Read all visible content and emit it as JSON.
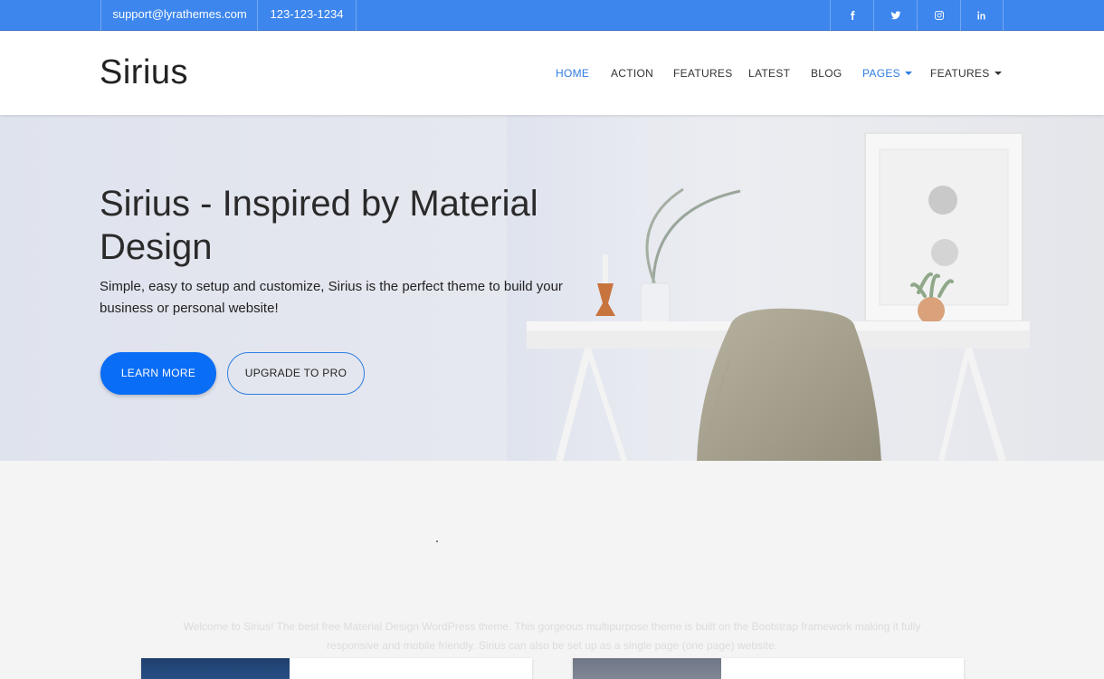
{
  "topbar": {
    "email": "support@lyrathemes.com",
    "phone": "123-123-1234",
    "social": [
      "facebook-icon",
      "twitter-icon",
      "instagram-icon",
      "linkedin-icon"
    ]
  },
  "header": {
    "logo": "Sirius",
    "nav": [
      {
        "label": "HOME",
        "active": true
      },
      {
        "label": "ACTION"
      },
      {
        "label": "FEATURES"
      },
      {
        "label": "LATEST"
      },
      {
        "label": "BLOG"
      },
      {
        "label": "PAGES",
        "active": true,
        "dropdown": true
      },
      {
        "label": "FEATURES",
        "dropdown": true
      }
    ]
  },
  "hero": {
    "title": "Sirius - Inspired by Material Design",
    "subtitle": "Simple, easy to setup and customize, Sirius is the perfect theme to build your business or personal website!",
    "primary_button": "LEARN MORE",
    "secondary_button": "UPGRADE TO PRO"
  },
  "intro": {
    "text": "Welcome to Sirius! The best free Material Design WordPress theme. This gorgeous multipurpose theme is built on the Bootstrap framework making it fully responsive and mobile friendly. Sirius can also be set up as a single page (one page) website."
  },
  "colors": {
    "topbar": "#3d86ed",
    "accent": "#2f7de1",
    "primary_button": "#0a6df5"
  }
}
